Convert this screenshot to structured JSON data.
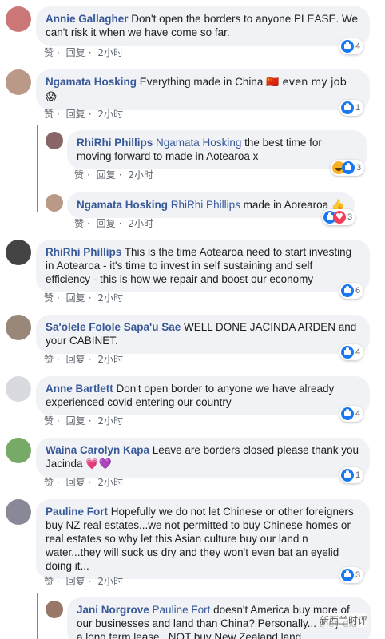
{
  "actions": {
    "like": "赞",
    "reply": "回复",
    "time": "2小时"
  },
  "comments": [
    {
      "author": "Annie Gallagher",
      "text": "Don't open the borders to anyone PLEASE. We can't risk it when we have come so far.",
      "reactions": "4",
      "avatar_color": "#c77"
    },
    {
      "author": "Ngamata Hosking",
      "text": "Everything made in China",
      "emoji": "🇨🇳 even my job 😱",
      "reactions": "1",
      "avatar_color": "#b98"
    },
    {
      "author": "RhiRhi Phillips",
      "mention": "Ngamata Hosking",
      "text": "the best time for moving forward to made in Aotearoa x",
      "reactions": "3",
      "avatar_color": "#866"
    },
    {
      "author": "Ngamata Hosking",
      "mention": "RhiRhi Phillips",
      "text": "made in Aorearoa 👍",
      "reactions": "3",
      "avatar_color": "#b98"
    },
    {
      "author": "RhiRhi Phillips",
      "text": "This is the time Aotearoa need to start investing in Aotearoa - it's time to invest in self sustaining and self efficiency - this is how we repair and boost our economy",
      "reactions": "6",
      "avatar_color": "#444"
    },
    {
      "author": "Sa'olele Folole Sapa'u Sae",
      "text": "WELL DONE JACINDA ARDEN and your CABINET.",
      "reactions": "4",
      "avatar_color": "#987"
    },
    {
      "author": "Anne Bartlett",
      "text": "Don't open border to anyone we have already experienced covid entering our country",
      "reactions": "4",
      "avatar_color": "#d8dadf"
    },
    {
      "author": "Waina Carolyn Kapa",
      "text": "Leave are borders closed please thank you Jacinda",
      "emoji": "💗💜",
      "reactions": "1",
      "avatar_color": "#7a6"
    },
    {
      "author": "Pauline Fort",
      "text": "Hopefully we do not let Chinese or other foreigners buy NZ real estates...we not permitted to buy Chinese homes or real estates so why let this Asian culture buy our land n water...they will suck us dry and they won't even bat an eyelid doing it...",
      "reactions": "3",
      "avatar_color": "#889"
    },
    {
      "author": "Jani Norgrove",
      "mention": "Pauline Fort",
      "text": "doesn't America buy more of our businesses and land than China? Personally... they did a long term lease...NOT buy New Zealand land.",
      "avatar_color": "#976"
    }
  ],
  "watermark": "新西兰时评"
}
